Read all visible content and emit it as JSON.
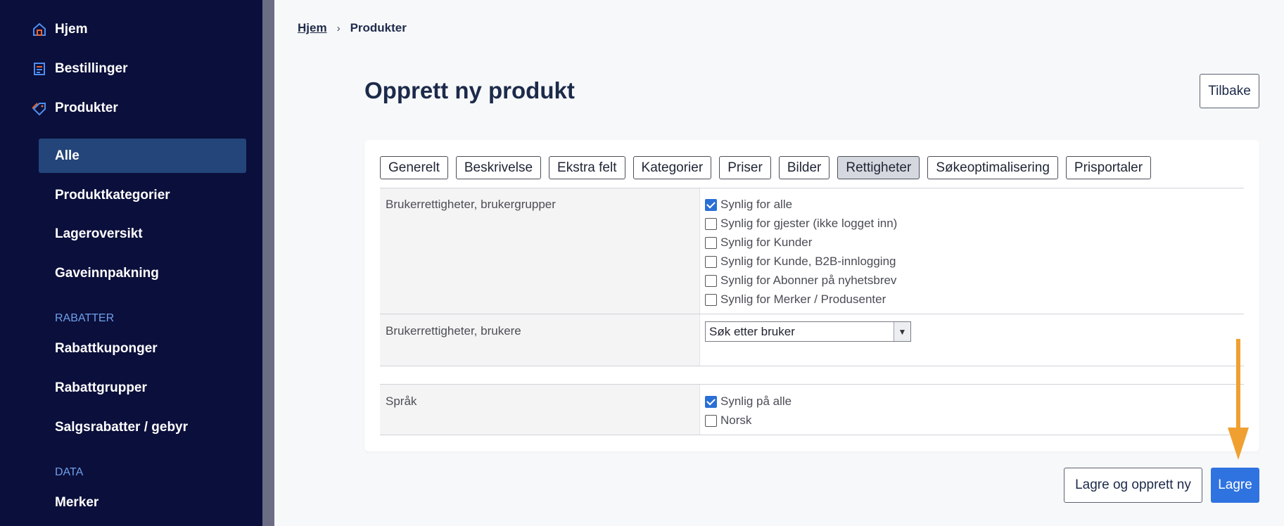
{
  "sidebar": {
    "items": [
      {
        "label": "Hjem",
        "icon": "home-icon"
      },
      {
        "label": "Bestillinger",
        "icon": "orders-icon"
      },
      {
        "label": "Produkter",
        "icon": "tag-icon"
      }
    ],
    "sub_items": [
      "Alle",
      "Produktkategorier",
      "Lageroversikt",
      "Gaveinnpakning"
    ],
    "section_rabatter": "RABATTER",
    "rabatter_items": [
      "Rabattkuponger",
      "Rabattgrupper",
      "Salgsrabatter / gebyr"
    ],
    "section_data": "DATA",
    "data_items": [
      "Merker"
    ]
  },
  "breadcrumb": {
    "home": "Hjem",
    "separator": "›",
    "current": "Produkter"
  },
  "page": {
    "title": "Opprett ny produkt",
    "back_label": "Tilbake"
  },
  "tabs": [
    "Generelt",
    "Beskrivelse",
    "Ekstra felt",
    "Kategorier",
    "Priser",
    "Bilder",
    "Rettigheter",
    "Søkeoptimalisering",
    "Prisportaler"
  ],
  "active_tab": "Rettigheter",
  "groups": {
    "label": "Brukerrettigheter, brukergrupper",
    "options": [
      {
        "label": "Synlig for alle",
        "checked": true
      },
      {
        "label": "Synlig for gjester (ikke logget inn)",
        "checked": false
      },
      {
        "label": "Synlig for Kunder",
        "checked": false
      },
      {
        "label": "Synlig for Kunde, B2B-innlogging",
        "checked": false
      },
      {
        "label": "Synlig for Abonner på nyhetsbrev",
        "checked": false
      },
      {
        "label": "Synlig for Merker / Produsenter",
        "checked": false
      }
    ]
  },
  "users": {
    "label": "Brukerrettigheter, brukere",
    "select_value": "Søk etter bruker"
  },
  "language": {
    "label": "Språk",
    "options": [
      {
        "label": "Synlig på alle",
        "checked": true
      },
      {
        "label": "Norsk",
        "checked": false
      }
    ]
  },
  "actions": {
    "save_new": "Lagre og opprett ny",
    "save": "Lagre"
  },
  "colors": {
    "sidebar_bg": "#0b0f3b",
    "accent": "#2f73e0",
    "arrow": "#f0a030"
  }
}
